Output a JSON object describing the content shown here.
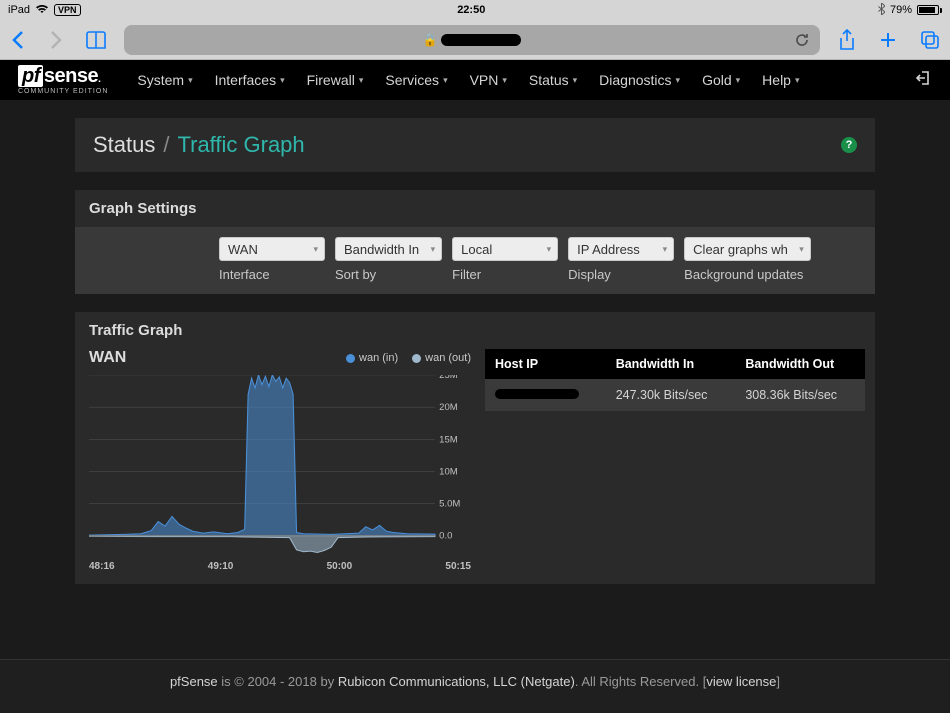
{
  "ipad": {
    "device": "iPad",
    "vpn": "VPN",
    "time": "22:50",
    "battery_pct": "79%"
  },
  "pfnav": {
    "brand_pf": "pf",
    "brand_sense": "sense",
    "edition": "COMMUNITY EDITION",
    "items": [
      "System",
      "Interfaces",
      "Firewall",
      "Services",
      "VPN",
      "Status",
      "Diagnostics",
      "Gold",
      "Help"
    ]
  },
  "breadcrumb": {
    "root": "Status",
    "sep": "/",
    "leaf": "Traffic Graph",
    "help": "?"
  },
  "settings": {
    "title": "Graph Settings",
    "fields": [
      {
        "value": "WAN",
        "label": "Interface"
      },
      {
        "value": "Bandwidth In",
        "label": "Sort by"
      },
      {
        "value": "Local",
        "label": "Filter"
      },
      {
        "value": "IP Address",
        "label": "Display"
      },
      {
        "value": "Clear graphs wh",
        "label": "Background updates"
      }
    ]
  },
  "traffic_graph": {
    "title": "Traffic Graph",
    "chart_title": "WAN",
    "legend_in": "wan (in)",
    "legend_out": "wan (out)"
  },
  "host_table": {
    "headers": [
      "Host IP",
      "Bandwidth In",
      "Bandwidth Out"
    ],
    "rows": [
      {
        "host": "(redacted)",
        "in": "247.30k Bits/sec",
        "out": "308.36k Bits/sec"
      }
    ]
  },
  "footer": {
    "t1": "pfSense",
    "t2": " is © 2004 - 2018 by ",
    "t3": "Rubicon Communications, LLC (Netgate)",
    "t4": ". All Rights Reserved. [",
    "t5": "view license",
    "t6": "]"
  },
  "chart_data": {
    "type": "line",
    "title": "WAN",
    "xlabel": "",
    "ylabel": "",
    "ylim": [
      -3000000,
      25000000
    ],
    "y_ticks": [
      "25M",
      "20M",
      "15M",
      "10M",
      "5.0M",
      "0.0"
    ],
    "x_ticks": [
      "48:16",
      "49:10",
      "50:00",
      "50:15"
    ],
    "series": [
      {
        "name": "wan (in)",
        "color": "#4a90d9",
        "points": [
          [
            0.0,
            100000
          ],
          [
            0.05,
            150000
          ],
          [
            0.1,
            200000
          ],
          [
            0.15,
            300000
          ],
          [
            0.18,
            800000
          ],
          [
            0.2,
            2200000
          ],
          [
            0.22,
            1500000
          ],
          [
            0.24,
            3000000
          ],
          [
            0.26,
            1800000
          ],
          [
            0.28,
            1200000
          ],
          [
            0.3,
            700000
          ],
          [
            0.33,
            400000
          ],
          [
            0.36,
            600000
          ],
          [
            0.4,
            300000
          ],
          [
            0.43,
            500000
          ],
          [
            0.45,
            1000000
          ],
          [
            0.46,
            22000000
          ],
          [
            0.47,
            24500000
          ],
          [
            0.48,
            23000000
          ],
          [
            0.49,
            25000000
          ],
          [
            0.5,
            23500000
          ],
          [
            0.51,
            24800000
          ],
          [
            0.52,
            23200000
          ],
          [
            0.53,
            25000000
          ],
          [
            0.54,
            24000000
          ],
          [
            0.55,
            24700000
          ],
          [
            0.56,
            23000000
          ],
          [
            0.57,
            24500000
          ],
          [
            0.58,
            23800000
          ],
          [
            0.59,
            22000000
          ],
          [
            0.6,
            500000
          ],
          [
            0.62,
            300000
          ],
          [
            0.7,
            200000
          ],
          [
            0.78,
            400000
          ],
          [
            0.8,
            1400000
          ],
          [
            0.82,
            900000
          ],
          [
            0.84,
            1600000
          ],
          [
            0.86,
            700000
          ],
          [
            0.88,
            500000
          ],
          [
            0.92,
            300000
          ],
          [
            1.0,
            250000
          ]
        ]
      },
      {
        "name": "wan (out)",
        "color": "#9fb8cc",
        "points": [
          [
            0.0,
            -80000
          ],
          [
            0.2,
            -150000
          ],
          [
            0.4,
            -120000
          ],
          [
            0.45,
            -200000
          ],
          [
            0.58,
            -300000
          ],
          [
            0.6,
            -2200000
          ],
          [
            0.62,
            -2500000
          ],
          [
            0.64,
            -2400000
          ],
          [
            0.66,
            -2600000
          ],
          [
            0.68,
            -2300000
          ],
          [
            0.7,
            -1800000
          ],
          [
            0.72,
            -300000
          ],
          [
            0.8,
            -200000
          ],
          [
            1.0,
            -150000
          ]
        ]
      }
    ]
  }
}
